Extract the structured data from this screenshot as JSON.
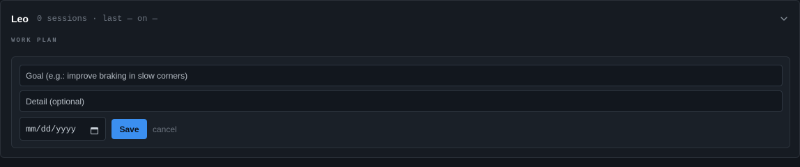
{
  "header": {
    "name": "Leo",
    "meta": "0 sessions · last — on —",
    "toggle_icon": "chevron-down-icon"
  },
  "section": {
    "label": "WORK PLAN"
  },
  "form": {
    "goal_placeholder": "Goal (e.g.: improve braking in slow corners)",
    "detail_placeholder": "Detail (optional)",
    "date_placeholder": "mm/dd/yyyy",
    "date_icon": "calendar-icon",
    "save_label": "Save",
    "cancel_label": "cancel"
  },
  "colors": {
    "background": "#161b22",
    "panel": "#1a2028",
    "accent": "#3b8ff0",
    "muted_text": "#6e7681"
  }
}
